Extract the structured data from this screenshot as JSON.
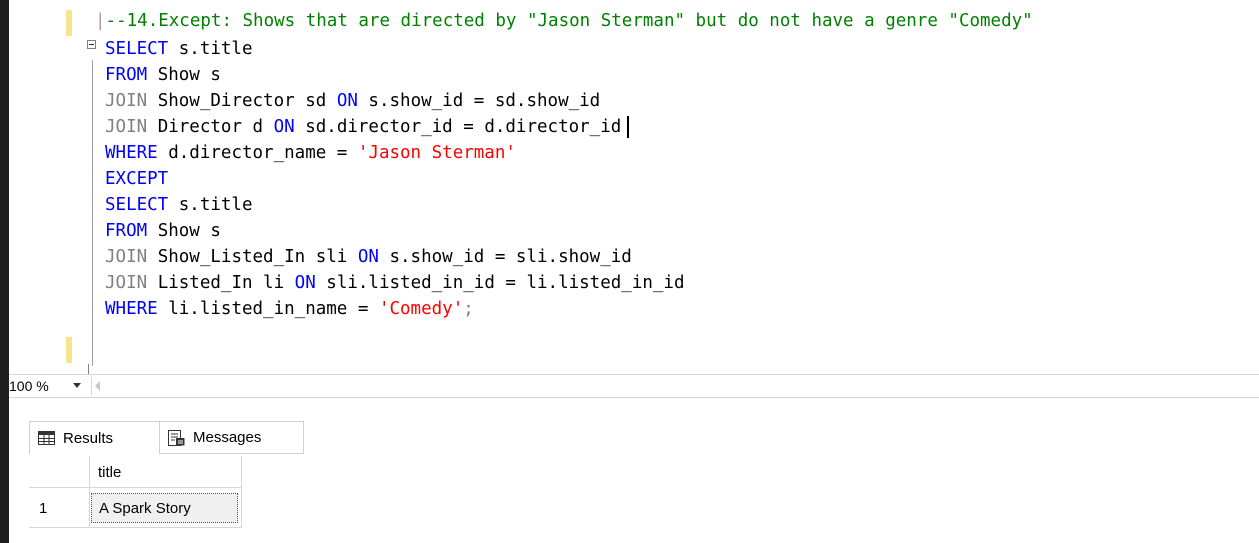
{
  "editor": {
    "comment": "--14.Except: Shows that are directed by \"Jason Sterman\" but do not have a genre \"Comedy\"",
    "kw_select": "SELECT",
    "kw_from": "FROM",
    "kw_join": "JOIN",
    "kw_on": "ON",
    "kw_where": "WHERE",
    "kw_except": "EXCEPT",
    "l1_rest": " s.title",
    "l2_rest": " Show s",
    "l3_mid": " Show_Director sd ",
    "l3_rest": " s.show_id = sd.show_id",
    "l4_mid": " Director d ",
    "l4_rest": " sd.director_id = d.director_id",
    "l5_rest": " d.director_name = ",
    "l5_str": "'Jason Sterman'",
    "l7_rest": " s.title",
    "l8_rest": " Show s",
    "l9_mid": " Show_Listed_In sli ",
    "l9_rest": " s.show_id = sli.show_id",
    "l10_mid": " Listed_In li ",
    "l10_rest": " sli.listed_in_id = li.listed_in_id",
    "l11_rest": " li.listed_in_name = ",
    "l11_str": "'Comedy'",
    "l11_end": ";"
  },
  "zoom": {
    "value": "100 %"
  },
  "tabs": {
    "results": "Results",
    "messages": "Messages"
  },
  "grid": {
    "column": "title",
    "rows": [
      {
        "num": "1",
        "title": "A Spark Story"
      }
    ]
  },
  "colors": {
    "keyword": "#0000ff",
    "string": "#ff0000",
    "comment": "#008000",
    "join_keyword": "#808080",
    "change_bar": "#f6e58d"
  }
}
